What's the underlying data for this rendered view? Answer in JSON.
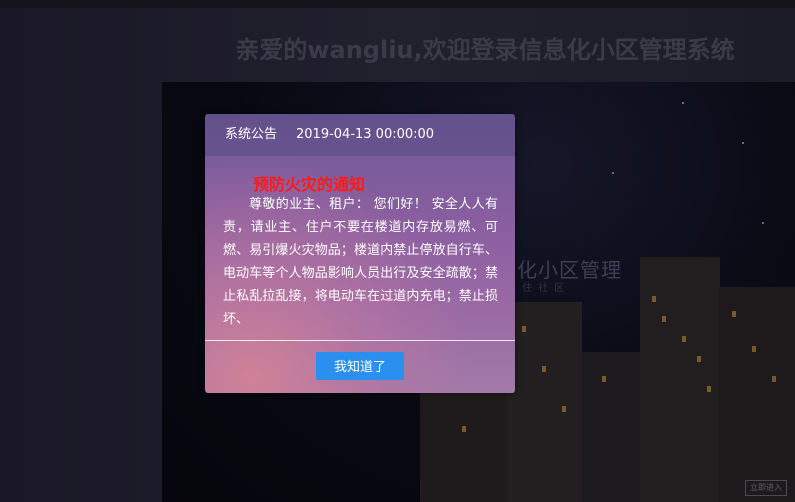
{
  "header": {
    "welcome_text": "亲爱的wangliu,欢迎登录信息化小区管理系统"
  },
  "hero": {
    "logo_text": "化小区管理",
    "logo_sub": "住社区",
    "enter_label": "立即进入"
  },
  "modal": {
    "label": "系统公告",
    "timestamp": "2019-04-13 00:00:00",
    "notice_title": "预防火灾的通知",
    "notice_body": "尊敬的业主、租户： 您们好！ 安全人人有责，请业主、住户不要在楼道内存放易燃、可燃、易引爆火灾物品；楼道内禁止停放自行车、电动车等个人物品影响人员出行及安全疏散；禁止私乱拉乱接，将电动车在过道内充电；禁止损坏、",
    "confirm_label": "我知道了"
  },
  "colors": {
    "notice_title": "#ff1a1a",
    "button": "#2b8ff0"
  }
}
